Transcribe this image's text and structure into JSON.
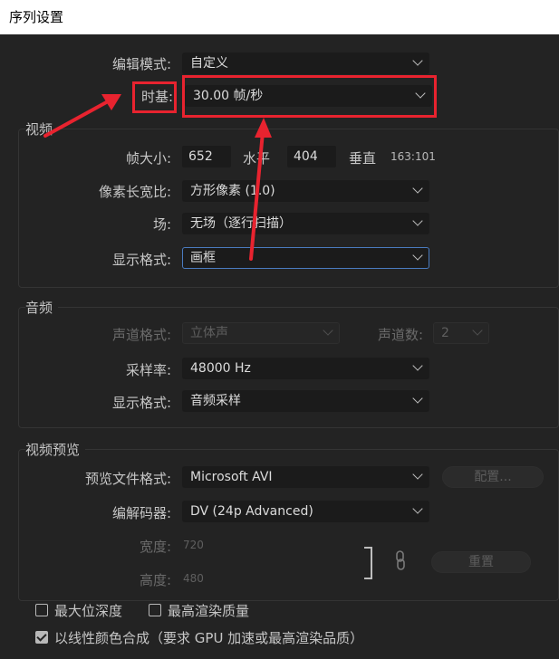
{
  "window": {
    "title": "序列设置"
  },
  "general": {
    "edit_mode_label": "编辑模式:",
    "edit_mode_value": "自定义",
    "timebase_label": "时基:",
    "timebase_value": "30.00 帧/秒"
  },
  "video": {
    "section_title": "视频",
    "frame_size_label": "帧大小:",
    "frame_width": "652",
    "horizontal_label": "水平",
    "frame_height": "404",
    "vertical_label": "垂直",
    "aspect_ratio": "163:101",
    "pixel_aspect_label": "像素长宽比:",
    "pixel_aspect_value": "方形像素 (1.0)",
    "fields_label": "场:",
    "fields_value": "无场（逐行扫描）",
    "display_format_label": "显示格式:",
    "display_format_value": "画框"
  },
  "audio": {
    "section_title": "音频",
    "channel_format_label": "声道格式:",
    "channel_format_value": "立体声",
    "channel_count_label": "声道数:",
    "channel_count_value": "2",
    "sample_rate_label": "采样率:",
    "sample_rate_value": "48000 Hz",
    "display_format_label": "显示格式:",
    "display_format_value": "音频采样"
  },
  "preview": {
    "section_title": "视频预览",
    "file_format_label": "预览文件格式:",
    "file_format_value": "Microsoft AVI",
    "configure_button": "配置...",
    "codec_label": "编解码器:",
    "codec_value": "DV (24p Advanced)",
    "width_label": "宽度:",
    "width_value": "720",
    "height_label": "高度:",
    "height_value": "480",
    "reset_button": "重置"
  },
  "options": {
    "max_bit_depth": "最大位深度",
    "max_render_quality": "最高渲染质量",
    "linear_color": "以线性颜色合成（要求 GPU 加速或最高渲染品质）"
  },
  "colors": {
    "annotation_red": "#e8232f",
    "focus_blue": "#4a7bbf",
    "panel_bg": "#232323"
  }
}
